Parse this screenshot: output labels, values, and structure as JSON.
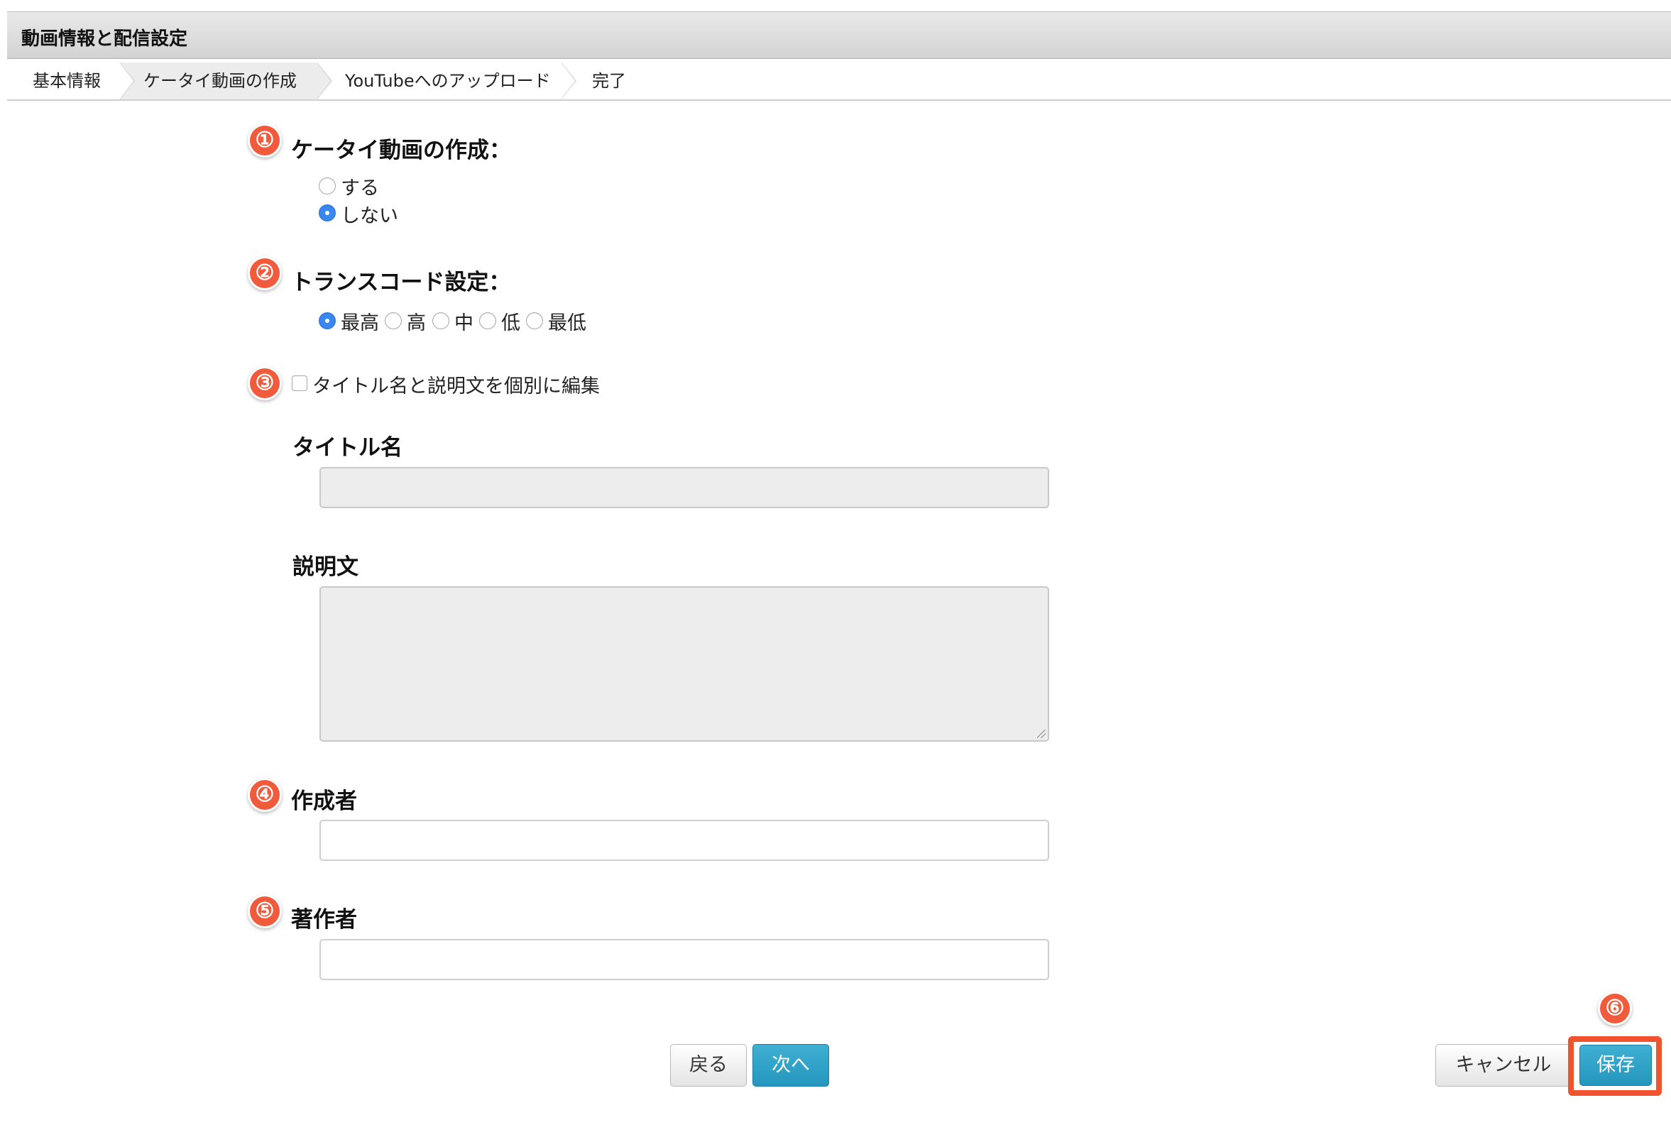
{
  "header": {
    "title": "動画情報と配信設定"
  },
  "steps": [
    "基本情報",
    "ケータイ動画の作成",
    "YouTubeへのアップロード",
    "完了"
  ],
  "markers": [
    "①",
    "②",
    "③",
    "④",
    "⑤",
    "⑥"
  ],
  "mobile_video": {
    "title": "ケータイ動画の作成：",
    "options": [
      "する",
      "しない"
    ],
    "selected": "しない"
  },
  "transcode": {
    "title": "トランスコード設定：",
    "options": [
      "最高",
      "高",
      "中",
      "低",
      "最低"
    ],
    "selected": "最高"
  },
  "individual_edit": {
    "label": "タイトル名と説明文を個別に編集",
    "checked": false
  },
  "title_field": {
    "label": "タイトル名",
    "value": ""
  },
  "description_field": {
    "label": "説明文",
    "value": ""
  },
  "creator_field": {
    "label": "作成者",
    "value": ""
  },
  "author_field": {
    "label": "著作者",
    "value": ""
  },
  "buttons": {
    "back": "戻る",
    "next": "次へ",
    "cancel": "キャンセル",
    "save": "保存"
  },
  "colors": {
    "marker": "#f15a3a",
    "primary": "#2596bd",
    "radio_selected": "#3b87f2",
    "highlight": "#f2532f"
  }
}
